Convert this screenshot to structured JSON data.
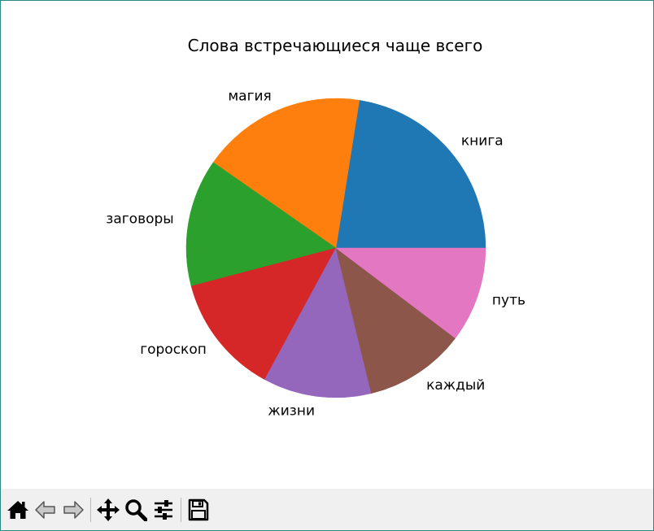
{
  "chart_data": {
    "type": "pie",
    "title": "Слова встречающиеся чаще всего",
    "labels": [
      "книга",
      "магия",
      "заговоры",
      "гороскоп",
      "жизни",
      "каждый",
      "путь"
    ],
    "values": [
      22.5,
      17.8,
      13.8,
      13.0,
      11.7,
      10.9,
      10.3
    ],
    "colors": [
      "#1f77b4",
      "#ff7f0e",
      "#2ca02c",
      "#d62728",
      "#9467bd",
      "#8c564b",
      "#e377c2"
    ],
    "start_angle_deg": 0,
    "direction": "counterclockwise"
  },
  "toolbar": {
    "icons": [
      "home-icon",
      "back-arrow-icon",
      "forward-arrow-icon",
      "pan-icon",
      "zoom-icon",
      "configure-icon",
      "save-icon"
    ]
  }
}
